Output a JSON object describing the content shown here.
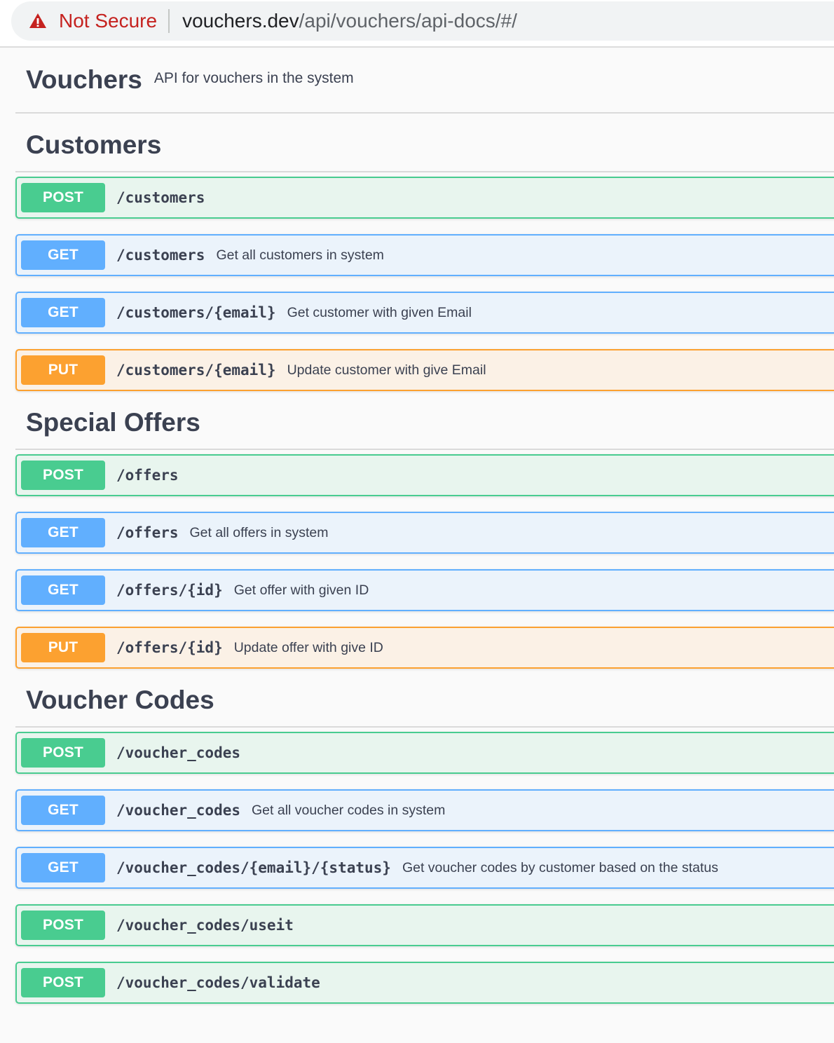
{
  "browser": {
    "security_label": "Not Secure",
    "url_host": "vouchers.dev",
    "url_path": "/api/vouchers/api-docs/#/",
    "warning_color": "#c5221f"
  },
  "info": {
    "title": "Vouchers",
    "description": "API for vouchers in the system"
  },
  "colors": {
    "post": "#49cc90",
    "get": "#61affe",
    "put": "#fca130"
  },
  "tags": [
    {
      "name": "Customers",
      "operations": [
        {
          "method": "POST",
          "path": "/customers",
          "summary": ""
        },
        {
          "method": "GET",
          "path": "/customers",
          "summary": "Get all customers in system"
        },
        {
          "method": "GET",
          "path": "/customers/{email}",
          "summary": "Get customer with given Email"
        },
        {
          "method": "PUT",
          "path": "/customers/{email}",
          "summary": "Update customer with give Email"
        }
      ]
    },
    {
      "name": "Special Offers",
      "operations": [
        {
          "method": "POST",
          "path": "/offers",
          "summary": ""
        },
        {
          "method": "GET",
          "path": "/offers",
          "summary": "Get all offers in system"
        },
        {
          "method": "GET",
          "path": "/offers/{id}",
          "summary": "Get offer with given ID"
        },
        {
          "method": "PUT",
          "path": "/offers/{id}",
          "summary": "Update offer with give ID"
        }
      ]
    },
    {
      "name": "Voucher Codes",
      "operations": [
        {
          "method": "POST",
          "path": "/voucher_codes",
          "summary": ""
        },
        {
          "method": "GET",
          "path": "/voucher_codes",
          "summary": "Get all voucher codes in system"
        },
        {
          "method": "GET",
          "path": "/voucher_codes/{email}/{status}",
          "summary": "Get voucher codes by customer based on the status"
        },
        {
          "method": "POST",
          "path": "/voucher_codes/useit",
          "summary": ""
        },
        {
          "method": "POST",
          "path": "/voucher_codes/validate",
          "summary": ""
        }
      ]
    }
  ]
}
